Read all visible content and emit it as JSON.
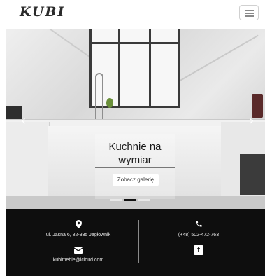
{
  "header": {
    "logo_text": "KUBI",
    "logo_subtitle": "",
    "menu_icon": "hamburger-menu-icon"
  },
  "hero": {
    "title": "Kuchnie na wymiar",
    "button_label": "Zobacz galerię",
    "prev_arrow": "‹",
    "next_arrow": "›",
    "slide_count": 3,
    "active_slide": 1
  },
  "footer": {
    "address": "ul. Jasna 6, 82-335 Jegłownik",
    "phone": "(+48) 502-472-763",
    "email": "kubimeble@icloud.com",
    "icons": {
      "location": "location-pin-icon",
      "phone": "phone-icon",
      "email": "envelope-icon",
      "social": "facebook-icon"
    }
  }
}
